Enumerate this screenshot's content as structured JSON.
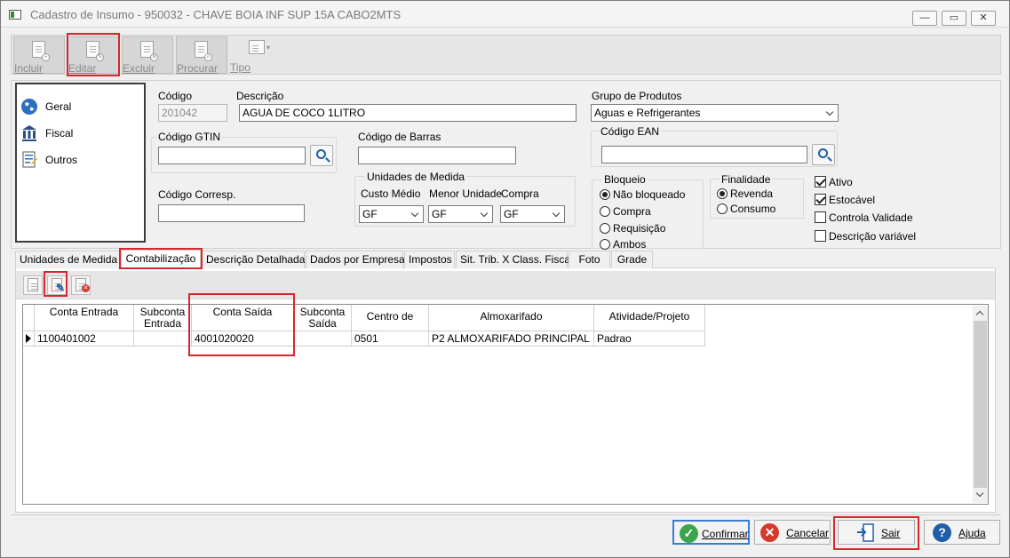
{
  "window": {
    "title": "Cadastro de Insumo - 950032 - CHAVE BOIA INF SUP 15A  CABO2MTS",
    "minimize": "—",
    "restore": "▭",
    "close": "✕"
  },
  "toolbar": {
    "incluir": "Incluir",
    "editar": "Editar",
    "excluir": "Excluir",
    "procurar": "Procurar",
    "tipo": "Tipo"
  },
  "nav": {
    "items": [
      "Geral",
      "Fiscal",
      "Outros"
    ]
  },
  "form": {
    "codigo_label": "Código",
    "codigo_value": "201042",
    "descricao_label": "Descrição",
    "descricao_value": "AGUA DE COCO 1LITRO",
    "grupo_label": "Grupo de Produtos",
    "grupo_value": "Aguas e Refrigerantes",
    "gtin_label": "Código GTIN",
    "gtin_value": "",
    "barras_label": "Código de Barras",
    "barras_value": "",
    "ean_label": "Código EAN",
    "ean_value": "",
    "corresp_label": "Código Corresp.",
    "corresp_value": "",
    "unidades": {
      "title": "Unidades de Medida",
      "custo_label": "Custo Médio",
      "custo_value": "GF",
      "menor_label": "Menor Unidade",
      "menor_value": "GF",
      "compra_label": "Compra",
      "compra_value": "GF"
    },
    "bloqueio": {
      "title": "Bloqueio",
      "options": [
        "Não bloqueado",
        "Compra",
        "Requisição",
        "Ambos"
      ]
    },
    "finalidade": {
      "title": "Finalidade",
      "options": [
        "Revenda",
        "Consumo"
      ]
    },
    "checks": [
      "Ativo",
      "Estocável",
      "Controla Validade",
      "Descrição variável"
    ]
  },
  "tabs": [
    "Unidades de Medida",
    "Contabilização",
    "Descrição Detalhada",
    "Dados por Empresa",
    "Impostos",
    "Sit. Trib. X Class. Fiscal",
    "Foto",
    "Grade"
  ],
  "grid": {
    "headers": [
      "Conta Entrada",
      "Subconta Entrada",
      "Conta Saída",
      "Subconta Saída",
      "Centro de Custo",
      "Almoxarifado",
      "Atividade/Projeto"
    ],
    "row": [
      "1100401002",
      "",
      "4001020020",
      "",
      "0501",
      "P2 ALMOXARIFADO PRINCIPAL",
      "Padrao"
    ]
  },
  "buttons": {
    "confirmar": "Confirmar",
    "cancelar": "Cancelar",
    "sair": "Sair",
    "ajuda": "Ajuda"
  },
  "colors": {
    "highlight": "#d9262c",
    "confirm": "#3aa54a",
    "cancel": "#d23a2c",
    "help": "#1f5fa8"
  }
}
